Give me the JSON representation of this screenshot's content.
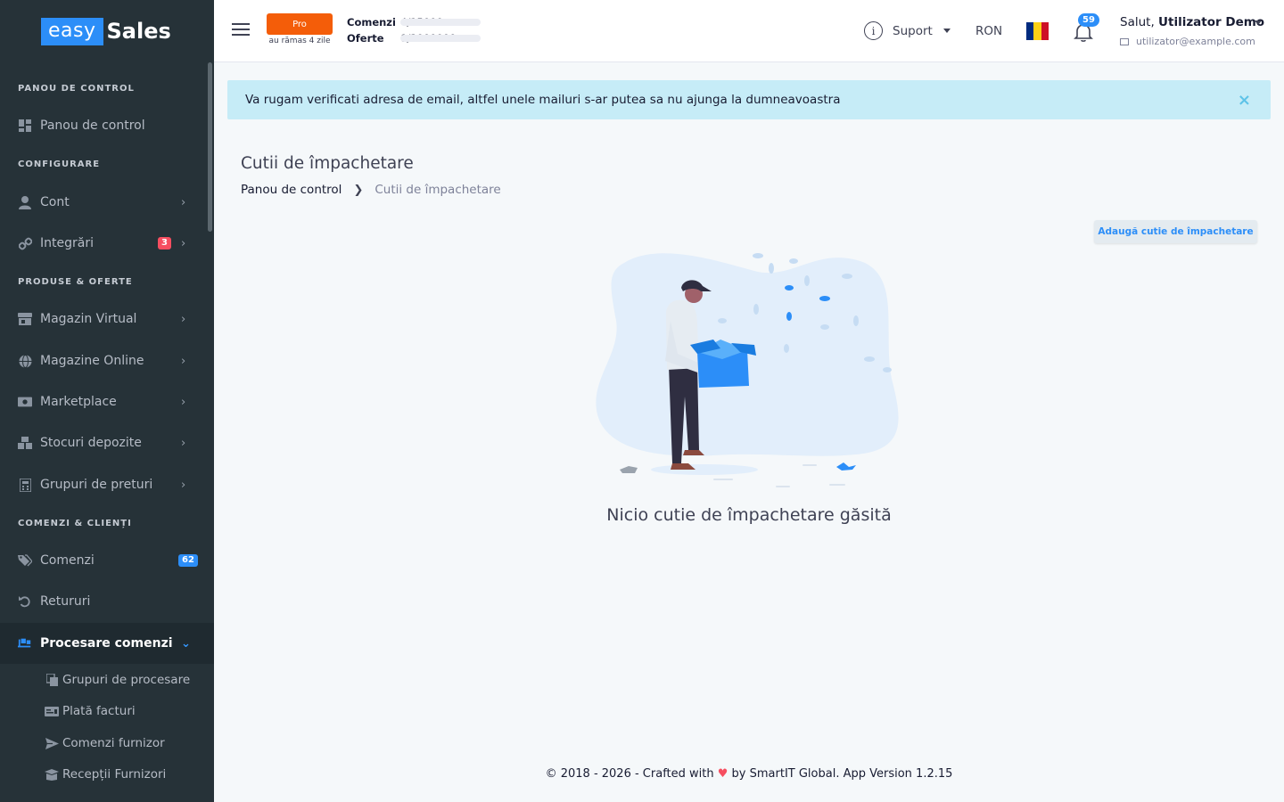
{
  "brand": {
    "part1": "easy",
    "part2": "Sales"
  },
  "sidebar": {
    "sections": [
      "PANOU DE CONTROL",
      "CONFIGURARE",
      "PRODUSE & OFERTE",
      "COMENZI & CLIENȚI"
    ],
    "items": [
      {
        "label": "Panou de control",
        "icon": "dashboard-icon"
      },
      {
        "label": "Cont",
        "icon": "user-icon"
      },
      {
        "label": "Integrări",
        "icon": "link-icon",
        "badge": "3",
        "badge_color": "#f64e60"
      },
      {
        "label": "Magazin Virtual",
        "icon": "store-icon"
      },
      {
        "label": "Magazine Online",
        "icon": "globe-icon"
      },
      {
        "label": "Marketplace",
        "icon": "money-icon"
      },
      {
        "label": "Stocuri depozite",
        "icon": "boxes-icon"
      },
      {
        "label": "Grupuri de preturi",
        "icon": "calculator-icon"
      },
      {
        "label": "Comenzi",
        "icon": "tags-icon",
        "badge": "62",
        "badge_color": "#2c8ef8"
      },
      {
        "label": "Retururi",
        "icon": "undo-icon"
      },
      {
        "label": "Procesare comenzi",
        "icon": "truck-loading-icon"
      }
    ],
    "subitems": [
      {
        "label": "Grupuri de procesare",
        "icon": "copy-icon"
      },
      {
        "label": "Plată facturi",
        "icon": "money-check-icon"
      },
      {
        "label": "Comenzi furnizor",
        "icon": "send-icon"
      },
      {
        "label": "Recepții Furnizori",
        "icon": "box-open-icon"
      }
    ]
  },
  "header": {
    "plan": "Pro",
    "plan_note": "au rămas 4 zile",
    "orders_label": "Comenzi",
    "orders_value": "4/15000",
    "orders_fill": 0.0003,
    "offers_label": "Oferte",
    "offers_value": "0/2000000",
    "offers_fill": 0,
    "support": "Suport",
    "currency": "RON",
    "notifications": "59",
    "greeting": "Salut,",
    "user_name": "Utilizator Demo",
    "user_email": "utilizator@example.com"
  },
  "alert": {
    "text": "Va rugam verificati adresa de email, altfel unele mailuri s-ar putea sa nu ajunga la dumneavoastra",
    "close": "×"
  },
  "page": {
    "title": "Cutii de împachetare",
    "breadcrumb_home": "Panou de control",
    "breadcrumb_current": "Cutii de împachetare",
    "add_button": "Adaugă cutie de împachetare",
    "empty_message": "Nicio cutie de împachetare găsită"
  },
  "footer": {
    "prefix": "© 2018 - 2026 - Crafted with",
    "suffix": "by SmartIT Global. App Version 1.2.15"
  },
  "colors": {
    "sidebar": "#263238",
    "accent": "#2c8ef8",
    "plan": "#f45d09",
    "alert": "#c6ecf7"
  }
}
